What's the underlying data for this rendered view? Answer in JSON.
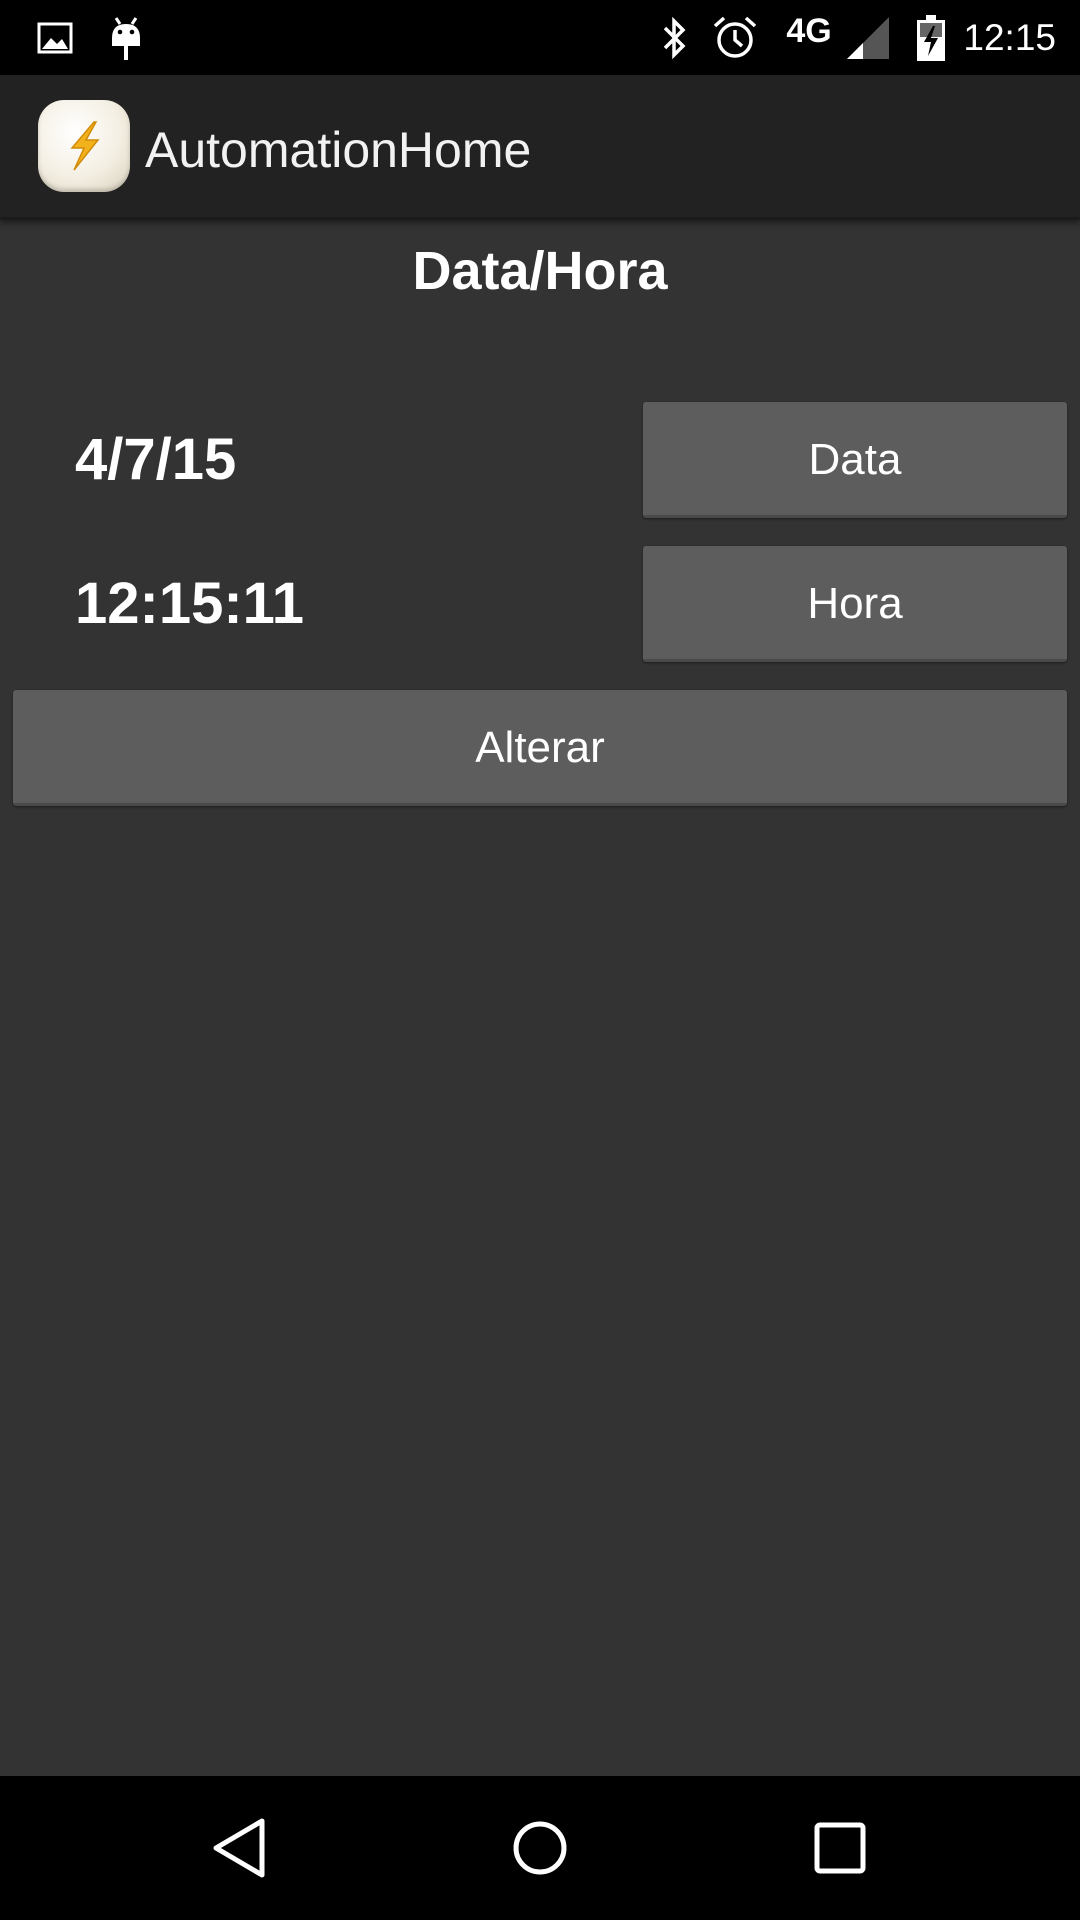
{
  "status_bar": {
    "time": "12:15",
    "network": "4G",
    "icons": [
      "image-icon",
      "android-debug-icon",
      "bluetooth-icon",
      "alarm-icon",
      "signal-icon",
      "battery-charging-icon"
    ]
  },
  "action_bar": {
    "title": "AutomationHome",
    "icon": "lightning-bolt-icon"
  },
  "main": {
    "heading": "Data/Hora",
    "date_value": "4/7/15",
    "time_value": "12:15:11",
    "date_button_label": "Data",
    "time_button_label": "Hora",
    "change_button_label": "Alterar"
  },
  "nav_bar": {
    "icons": [
      "back-icon",
      "home-icon",
      "recents-icon"
    ]
  },
  "colors": {
    "background": "#333333",
    "status_bar": "#000000",
    "action_bar": "#222222",
    "button": "#5d5d5d",
    "bolt": "#f2b21b"
  }
}
